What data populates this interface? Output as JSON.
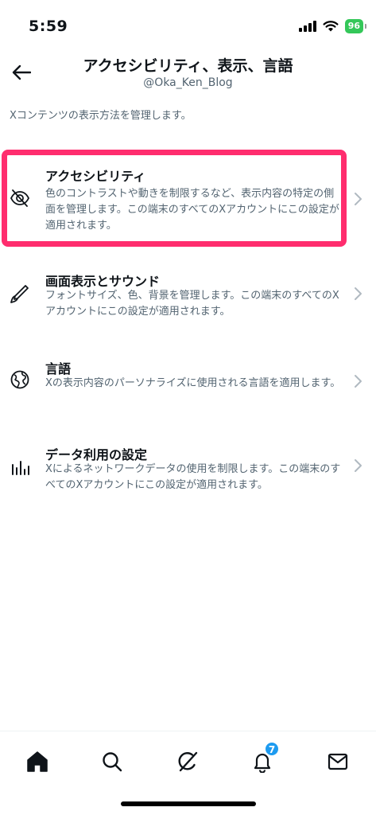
{
  "status_bar": {
    "time": "5:59",
    "battery": "96"
  },
  "header": {
    "title": "アクセシビリティ、表示、言語",
    "handle": "@Oka_Ken_Blog"
  },
  "description": "Xコンテンツの表示方法を管理します。",
  "items": [
    {
      "title": "アクセシビリティ",
      "desc": "色のコントラストや動きを制限するなど、表示内容の特定の側面を管理します。この端末のすべてのXアカウントにこの設定が適用されます。"
    },
    {
      "title": "画面表示とサウンド",
      "desc": "フォントサイズ、色、背景を管理します。この端末のすべてのXアカウントにこの設定が適用されます。"
    },
    {
      "title": "言語",
      "desc": "Xの表示内容のパーソナライズに使用される言語を適用します。"
    },
    {
      "title": "データ利用の設定",
      "desc": "Xによるネットワークデータの使用を制限します。この端末のすべてのXアカウントにこの設定が適用されます。"
    }
  ],
  "nav": {
    "notification_count": "7"
  },
  "colors": {
    "highlight": "#ff2d6e",
    "accent": "#1d9bf0",
    "secondary_text": "#536471"
  }
}
